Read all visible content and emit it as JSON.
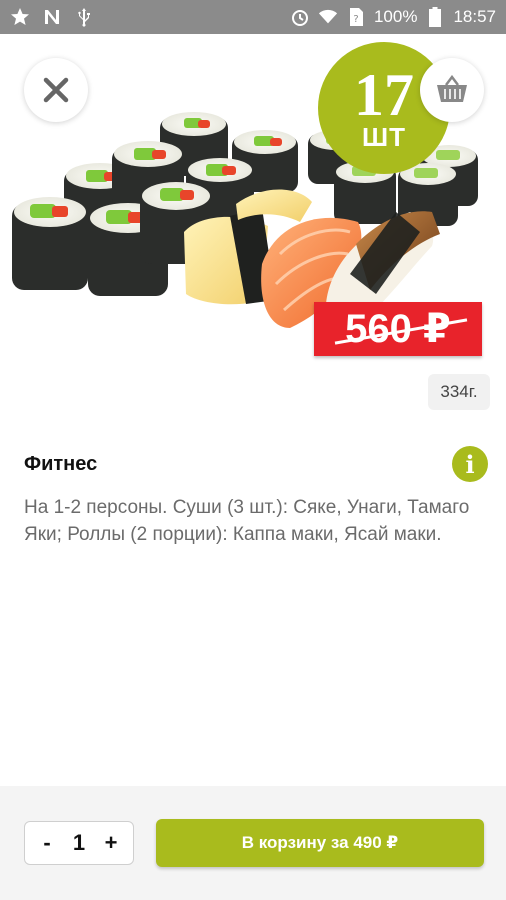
{
  "status_bar": {
    "battery_percent": "100%",
    "time": "18:57",
    "icons": [
      "star-icon",
      "n-icon",
      "usb-icon",
      "alarm-icon",
      "wifi-icon",
      "sim-icon",
      "battery-icon"
    ]
  },
  "hero": {
    "close_icon": "close-icon",
    "basket_icon": "basket-icon",
    "quantity_number": "17",
    "quantity_unit": "ШТ",
    "old_price": "560 ₽",
    "weight": "334г."
  },
  "product": {
    "name": "Фитнес",
    "info_icon": "info-icon",
    "description": "На 1-2 персоны. Суши (3 шт.): Сяке, Унаги, Тамаго Яки; Роллы (2 порции): Каппа маки, Ясай маки."
  },
  "cart_bar": {
    "minus_label": "-",
    "quantity": "1",
    "plus_label": "+",
    "add_to_cart_label": "В корзину за 490 ₽"
  },
  "colors": {
    "accent": "#a9bb1d",
    "old_price_bg": "#e8232b",
    "status_bar": "#8b8b8b"
  }
}
